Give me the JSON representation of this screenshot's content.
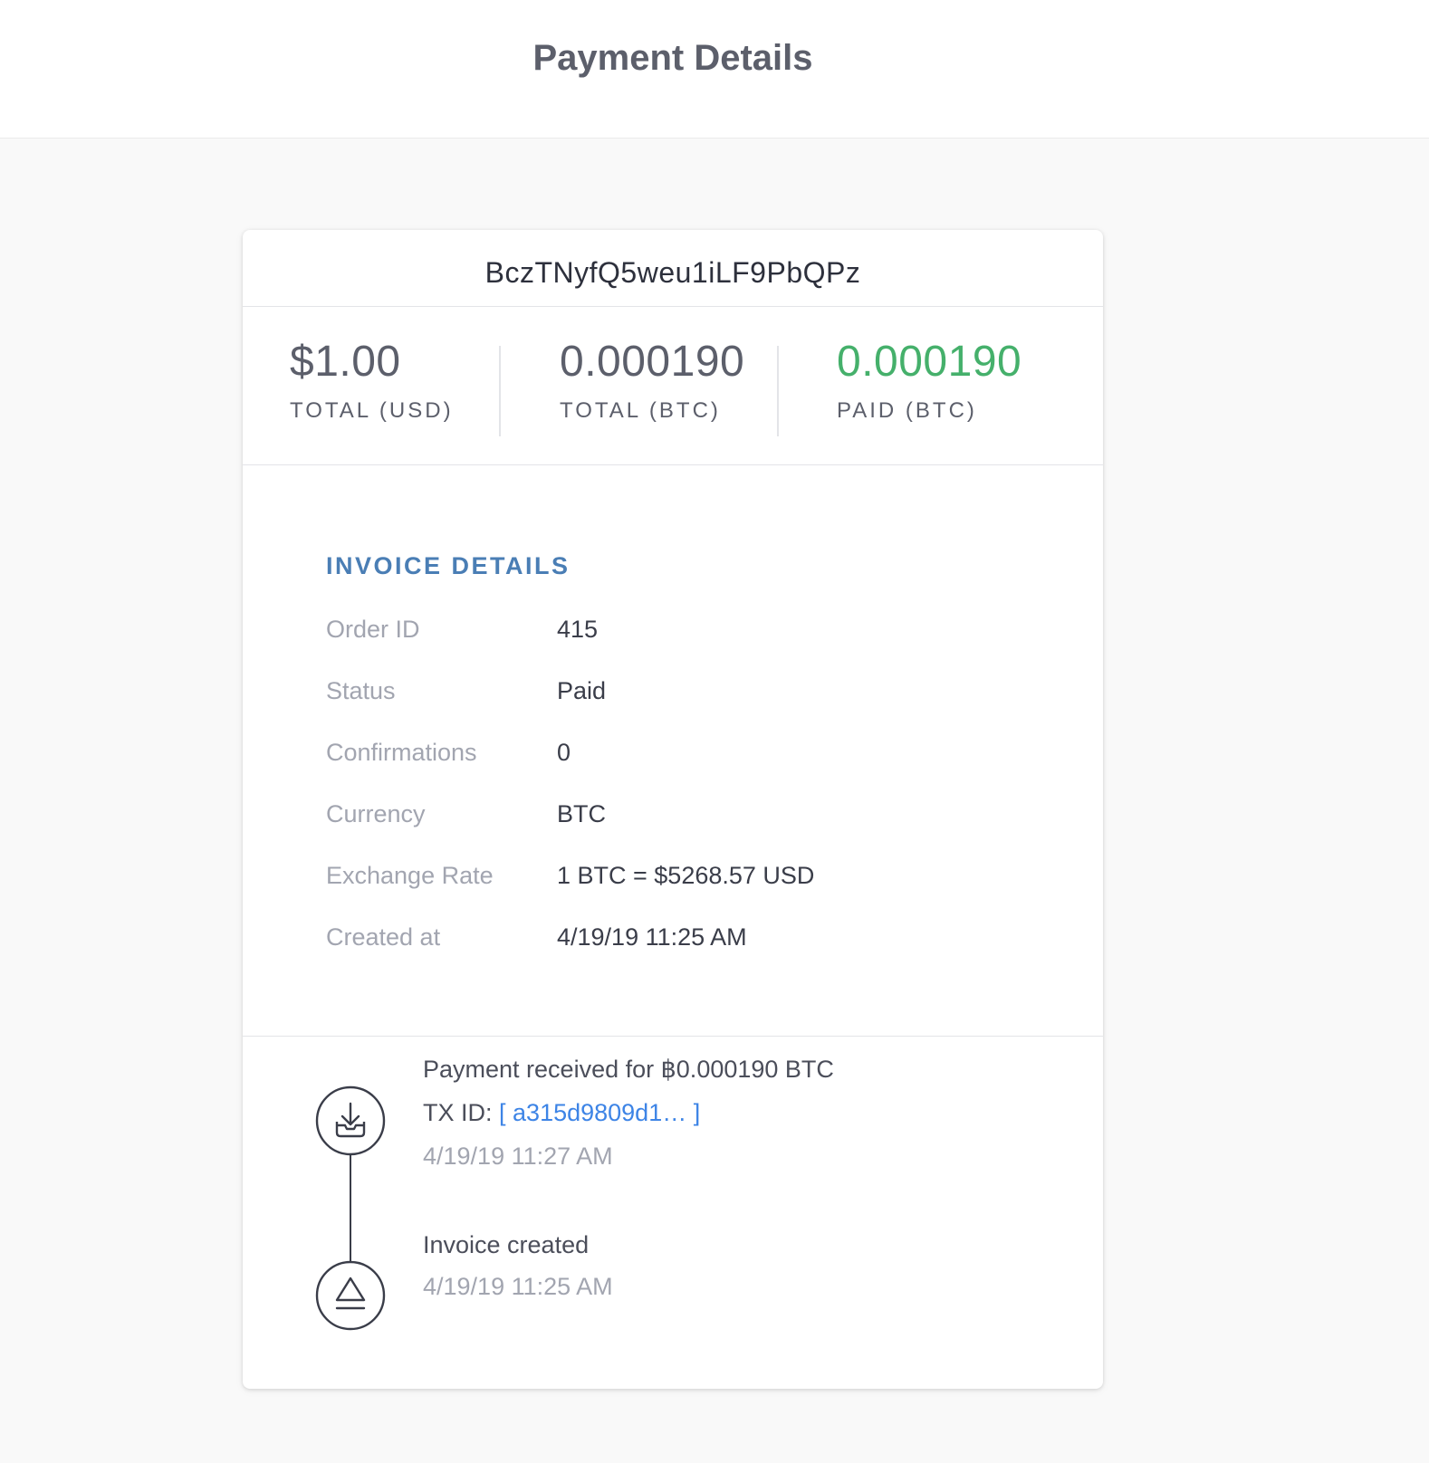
{
  "header": {
    "title": "Payment Details"
  },
  "invoice": {
    "id": "BczTNyfQ5weu1iLF9PbQPz",
    "totals": [
      {
        "value": "$1.00",
        "label": "TOTAL (USD)"
      },
      {
        "value": "0.000190",
        "label": "TOTAL (BTC)"
      },
      {
        "value": "0.000190",
        "label": "PAID (BTC)"
      }
    ],
    "paid_color": "#45b06b"
  },
  "details": {
    "title": "INVOICE DETAILS",
    "rows": [
      {
        "label": "Order ID",
        "value": "415"
      },
      {
        "label": "Status",
        "value": "Paid"
      },
      {
        "label": "Confirmations",
        "value": "0"
      },
      {
        "label": "Currency",
        "value": "BTC"
      },
      {
        "label": "Exchange Rate",
        "value": "1 BTC = $5268.57 USD"
      },
      {
        "label": "Created at",
        "value": "4/19/19 11:25 AM"
      }
    ]
  },
  "timeline": [
    {
      "icon": "download-tray-icon",
      "text": "Payment received for ฿0.000190 BTC",
      "tx_prefix": "TX ID:",
      "tx_link": "[ a315d9809d1…  ]",
      "time": "4/19/19 11:27 AM"
    },
    {
      "icon": "eject-icon",
      "text": "Invoice created",
      "time": "4/19/19 11:25 AM"
    }
  ]
}
